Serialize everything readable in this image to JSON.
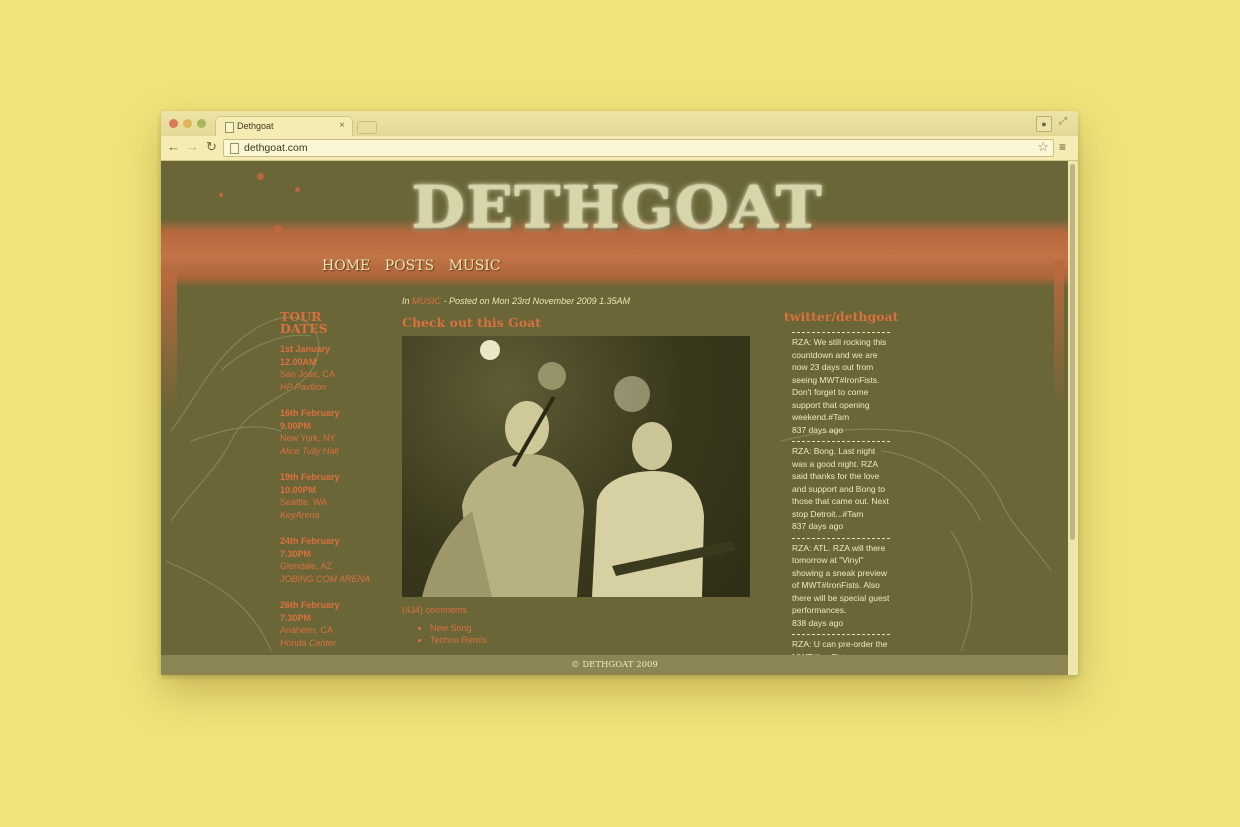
{
  "browser": {
    "tab_title": "Dethgoat",
    "tab_close": "×",
    "url": "dethgoat.com",
    "back": "←",
    "forward": "→",
    "reload": "↻",
    "star": "☆",
    "menu": "≡",
    "fullscreen": "⤢",
    "profile": "●"
  },
  "site": {
    "logo": "DETHGOAT",
    "nav": [
      "HOME",
      "POSTS",
      "MUSIC"
    ]
  },
  "tour": {
    "title_line1": "TOUR",
    "title_line2": "DATES",
    "shows": [
      {
        "date": "1st January",
        "time": "12.00AM",
        "city": "San Jose, CA",
        "venue": "HP Pavilion"
      },
      {
        "date": "16th February",
        "time": "9.00PM",
        "city": "New York, NY",
        "venue": "Alice Tully Hall"
      },
      {
        "date": "19th February",
        "time": "10.00PM",
        "city": "Seattle, WA",
        "venue": "KeyArena"
      },
      {
        "date": "24th February",
        "time": "7.30PM",
        "city": "Glendale, AZ",
        "venue": "JOBING.COM ARENA"
      },
      {
        "date": "26th February",
        "time": "7.30PM",
        "city": "Anaheim, CA",
        "venue": "Honda Center"
      }
    ]
  },
  "post": {
    "meta_prefix": "In ",
    "category": "MUSIC",
    "meta_suffix": " - Posted on Mon 23rd November 2009 1.35AM",
    "title": "Check out this Goat",
    "comments": "(434) comments",
    "songs": [
      "New Song",
      "Techno Remix"
    ]
  },
  "twitter": {
    "title": "twitter/dethgoat",
    "tweets": [
      {
        "text": "RZA: We still rocking this countdown and we are now 23 days out from seeing MWT#IronFists. Don't forget to come support that opening weekend.#Tam",
        "ago": "837 days ago"
      },
      {
        "text": "RZA: Bong. Last night was a good night. RZA said thanks for the love and support and Bong to those that came out. Next stop Detroit...#Tam",
        "ago": "837 days ago"
      },
      {
        "text": "RZA: ATL. RZA will there tomorrow at \"Vinyl\" showing a sneak preview of MWT#IronFists. Also there will be special guest performances.",
        "ago": "838 days ago"
      },
      {
        "text": "RZA: U can pre-order the MWT#IronFists",
        "ago": ""
      }
    ]
  },
  "footer": "© DETHGOAT 2009",
  "colors": {
    "desk": "#f0e37a",
    "page_bg": "#6a6638",
    "accent": "#d9713e",
    "splatter": "#c17446"
  }
}
